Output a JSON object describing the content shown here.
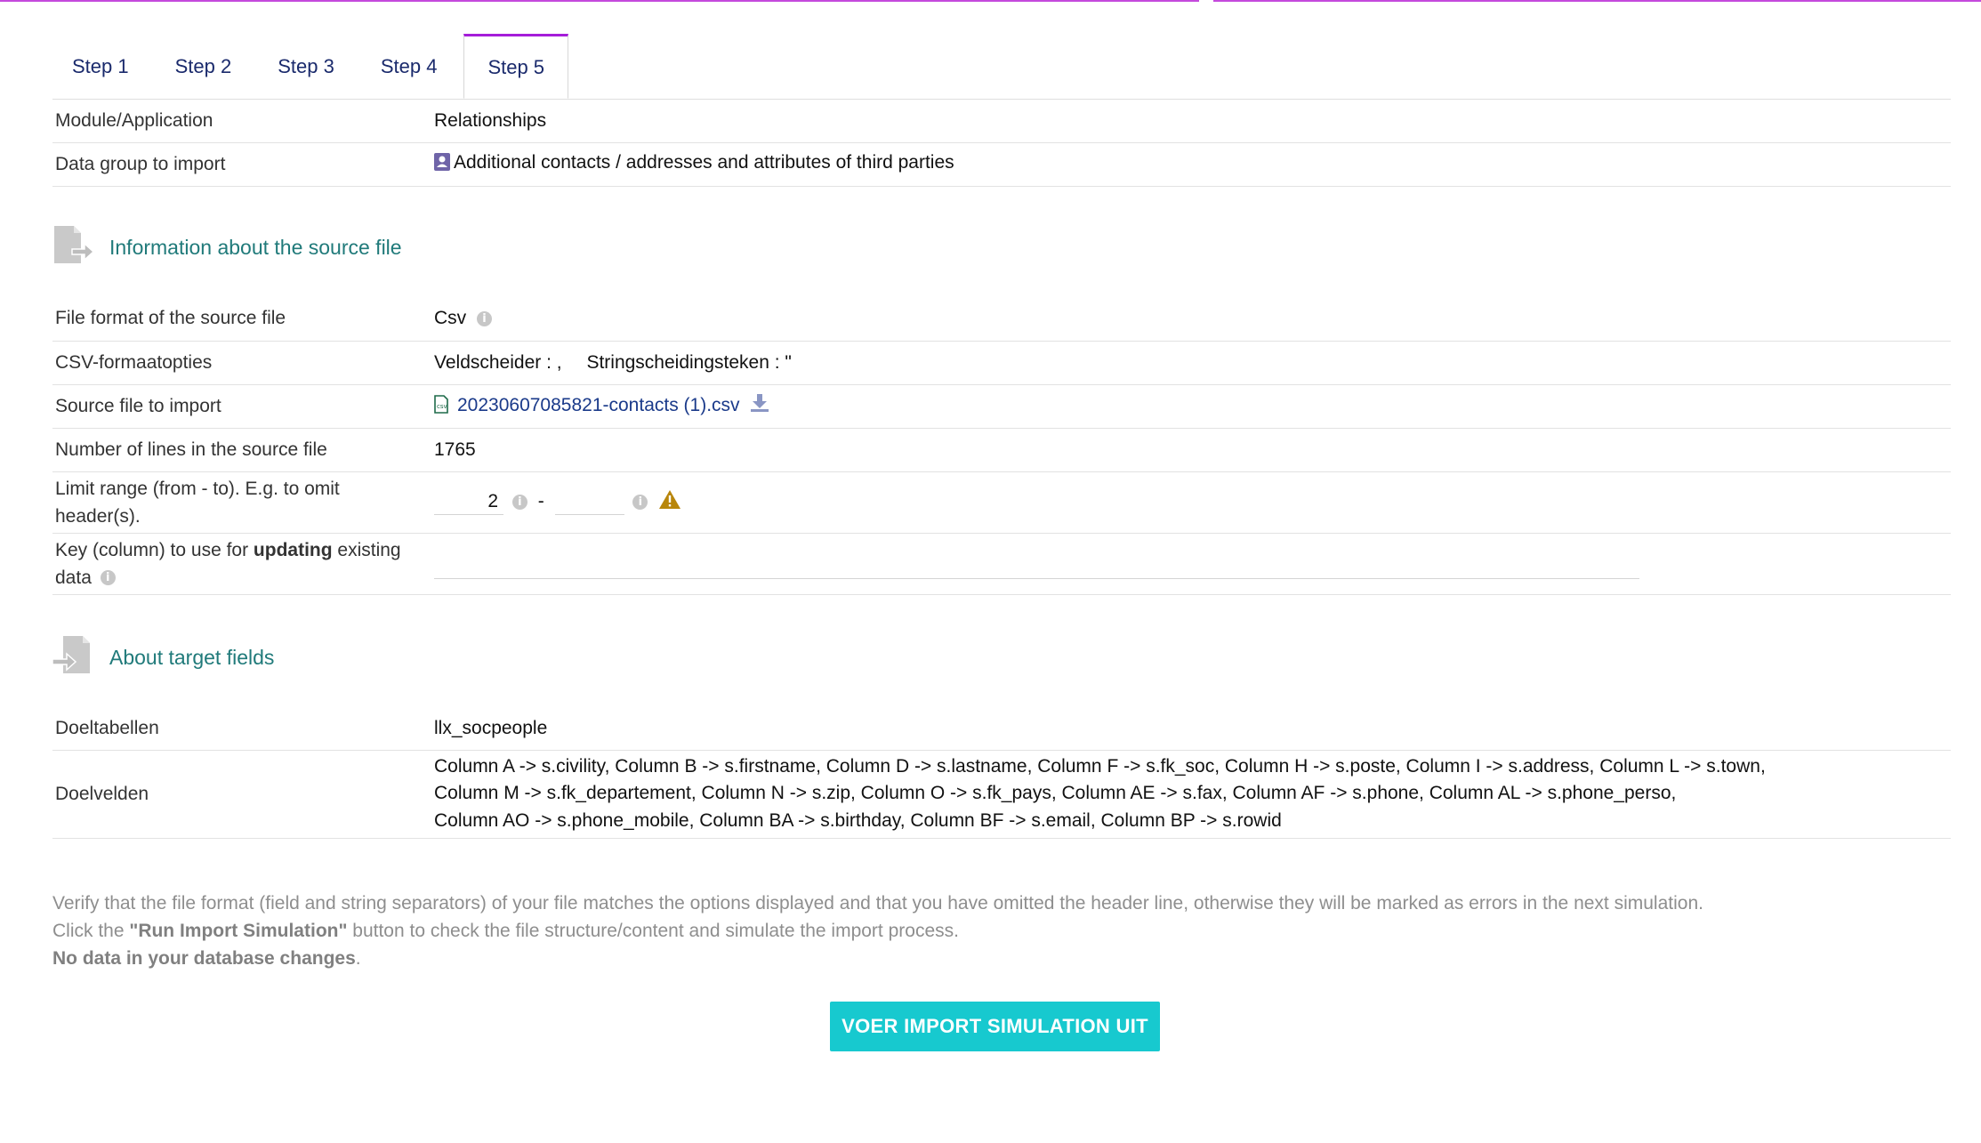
{
  "tabs": [
    "Step 1",
    "Step 2",
    "Step 3",
    "Step 4",
    "Step 5"
  ],
  "active_tab": "Step 5",
  "general": {
    "module_label": "Module/Application",
    "module_value": "Relationships",
    "datagroup_label": "Data group to import",
    "datagroup_value": "Additional contacts / addresses and attributes of third parties"
  },
  "source_section": {
    "title": "Information about the source file",
    "format_label": "File format of the source file",
    "format_value": "Csv",
    "csv_label": "CSV-formaatopties",
    "csv_field_sep": "Veldscheider : ,",
    "csv_string_sep": "Stringscheidingsteken : \"",
    "file_label": "Source file to import",
    "file_value": "20230607085821-contacts (1).csv",
    "lines_label": "Number of lines in the source file",
    "lines_value": "1765",
    "range_label": "Limit range (from - to). E.g. to omit header(s).",
    "range_from": "2",
    "range_to": "",
    "range_dash": "-",
    "key_label_pre": "Key (column) to use for ",
    "key_label_bold": "updating",
    "key_label_post": " existing data"
  },
  "target_section": {
    "title": "About target fields",
    "tables_label": "Doeltabellen",
    "tables_value": "llx_socpeople",
    "fields_label": "Doelvelden",
    "fields_line1": "Column A -> s.civility, Column B -> s.firstname, Column D -> s.lastname, Column F -> s.fk_soc, Column H -> s.poste, Column I -> s.address, Column L -> s.town,",
    "fields_line2": "Column M -> s.fk_departement, Column N -> s.zip, Column O -> s.fk_pays, Column AE -> s.fax, Column AF -> s.phone, Column AL -> s.phone_perso,",
    "fields_line3": "Column AO -> s.phone_mobile, Column BA -> s.birthday, Column BF -> s.email, Column BP -> s.rowid"
  },
  "notes": {
    "line1": "Verify that the file format (field and string separators) of your file matches the options displayed and that you have omitted the header line, otherwise they will be marked as errors in the next simulation.",
    "line2_pre": "Click the ",
    "line2_bold": "\"Run Import Simulation\"",
    "line2_post": " button to check the file structure/content and simulate the import process.",
    "line3_bold": "No data in your database changes",
    "line3_post": "."
  },
  "run_button": "VOER IMPORT SIMULATION UIT",
  "colors": {
    "accent_purple": "#a51dd9",
    "teal_title": "#207a7a",
    "button": "#17c9cf",
    "warning": "#b8860b"
  }
}
